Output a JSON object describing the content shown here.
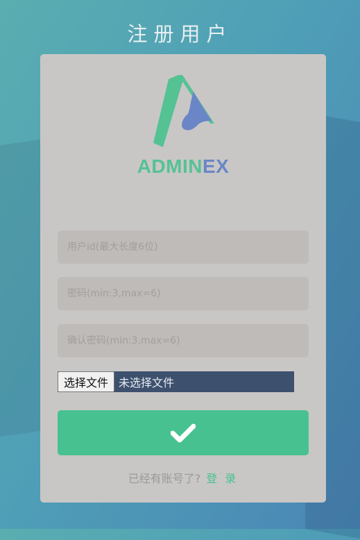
{
  "page": {
    "title": "注册用户"
  },
  "brand": {
    "logo_part1": "ADMIN",
    "logo_part2": "EX"
  },
  "form": {
    "user_id_placeholder": "用户id(最大长度6位)",
    "password_placeholder": "密码(min:3,max=6)",
    "confirm_password_placeholder": "确认密码(min:3,max=6)",
    "file_button_label": "选择文件",
    "file_status": "未选择文件"
  },
  "footer": {
    "prompt": "已经有账号了?",
    "login_link": "登 录"
  },
  "colors": {
    "accent": "#48c190",
    "brand_blue": "#6a86c7",
    "panel": "#c9c7c6"
  }
}
